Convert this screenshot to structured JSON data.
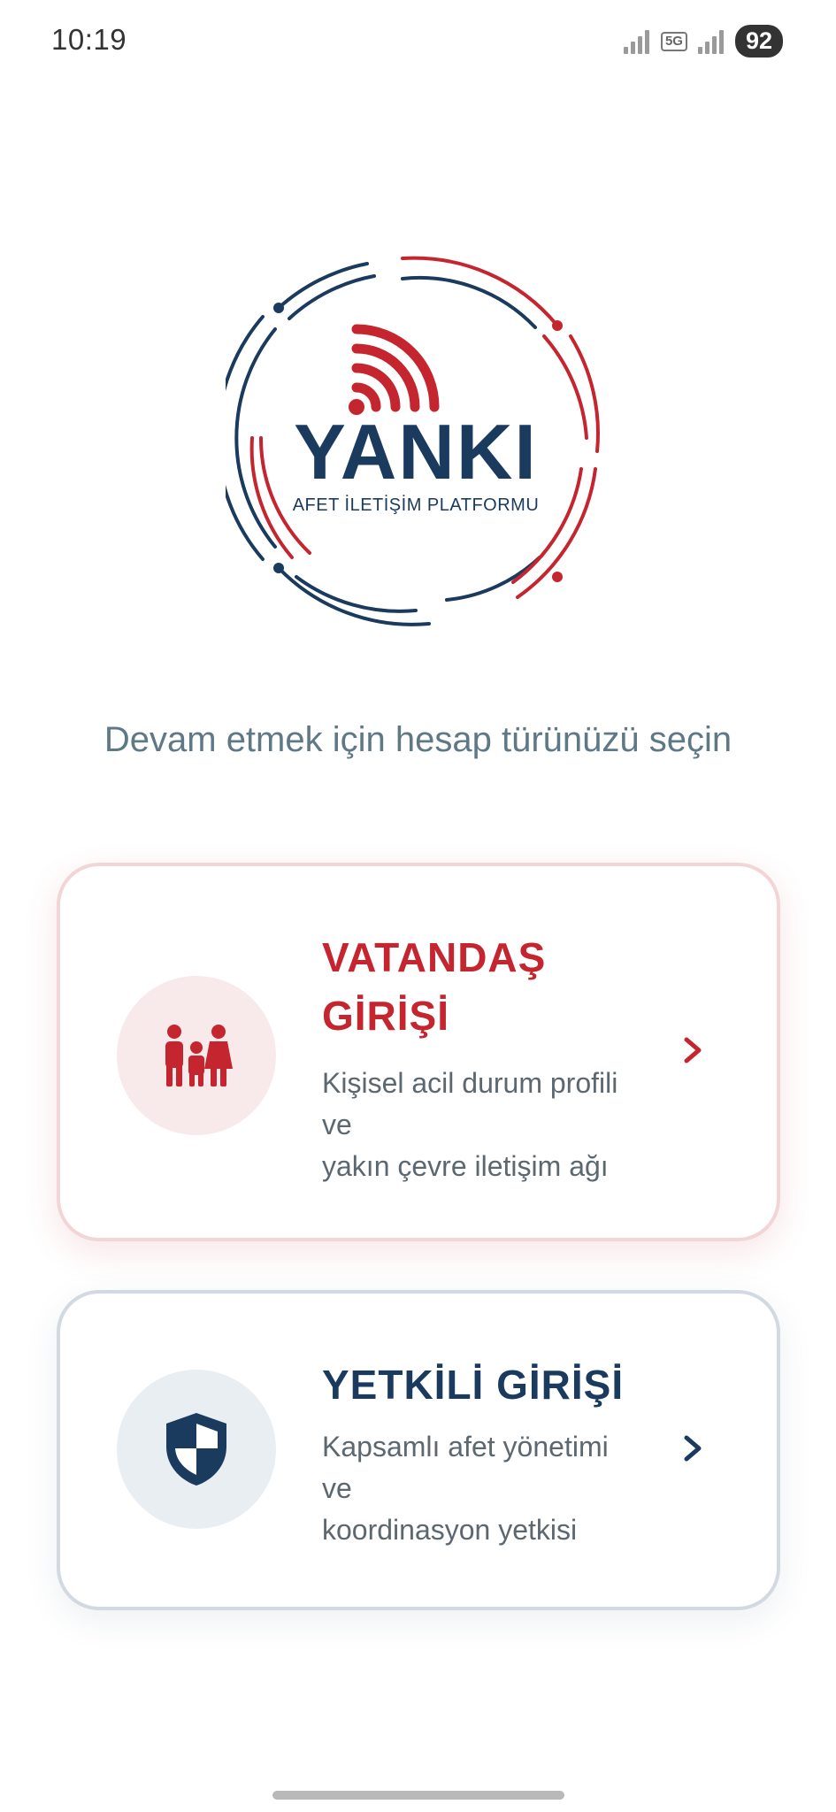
{
  "status_bar": {
    "time": "10:19",
    "network": "5G",
    "battery": "92"
  },
  "logo": {
    "wordmark": "YANKI",
    "tagline": "AFET İLETİŞİM PLATFORMU"
  },
  "prompt": "Devam etmek için hesap türünüzü seçin",
  "cards": [
    {
      "title_line1": "VATANDAŞ",
      "title_line2": "GİRİŞİ",
      "desc_line1": "Kişisel acil durum profili",
      "desc_line2": "ve",
      "desc_line3": "yakın çevre iletişim ağı",
      "icon": "family-icon",
      "accent": "#c4252e"
    },
    {
      "title": "YETKİLİ GİRİŞİ",
      "desc_line1": "Kapsamlı afet yönetimi",
      "desc_line2": "ve",
      "desc_line3": "koordinasyon yetkisi",
      "icon": "shield-icon",
      "accent": "#1a3a5e"
    }
  ]
}
